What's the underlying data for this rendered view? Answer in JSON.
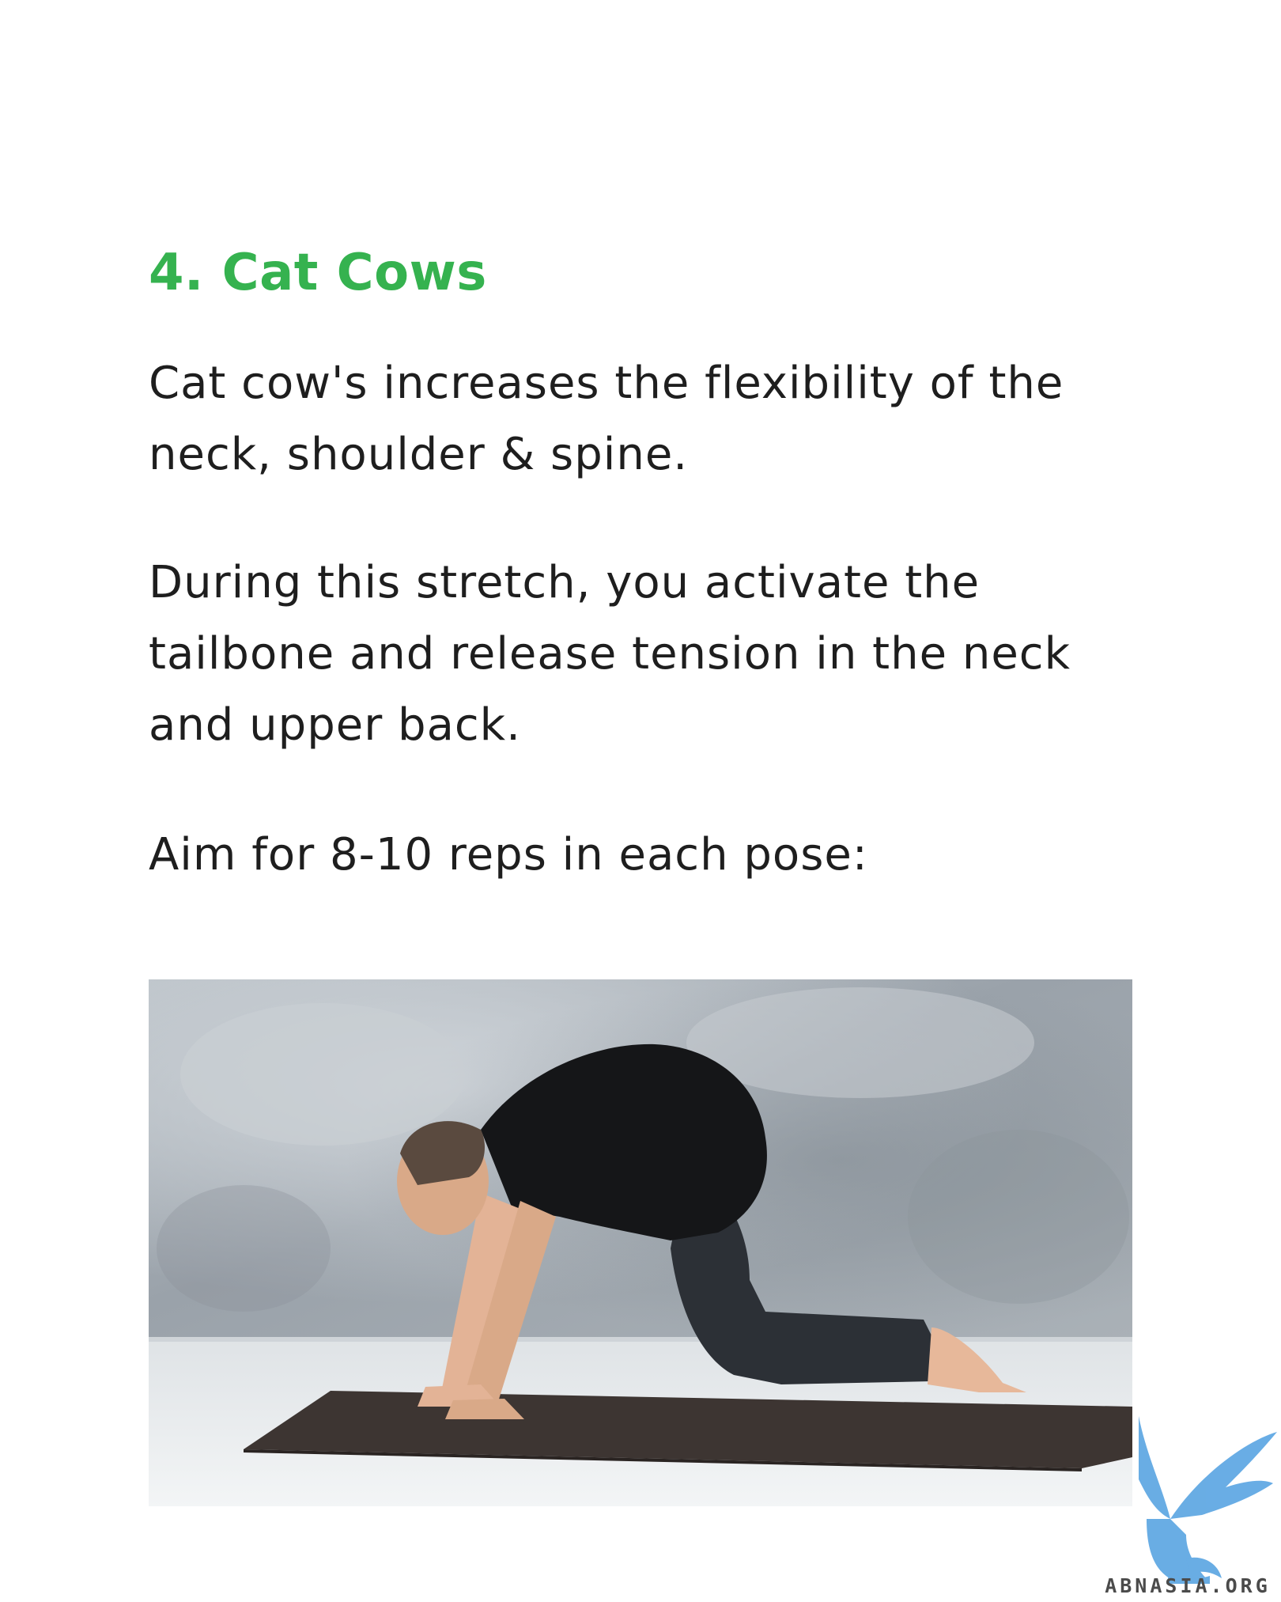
{
  "heading": "4. Cat Cows",
  "paragraphs": {
    "p1_line1": "Cat cow's increases the flexibility of the",
    "p1_line2": "neck, shoulder & spine.",
    "p2_line1": "During this stretch, you activate the",
    "p2_line2": "tailbone and release tension in the neck",
    "p2_line3": "and upper back.",
    "p3_line1": "Aim for 8-10 reps in each pose:"
  },
  "watermark": {
    "text": "ABNASIA.ORG",
    "icon": "griffin-logo-icon"
  },
  "colors": {
    "heading": "#35b24f",
    "body_text": "#1e1e1e",
    "background": "#ffffff",
    "watermark_blue": "#4f9fe0"
  }
}
